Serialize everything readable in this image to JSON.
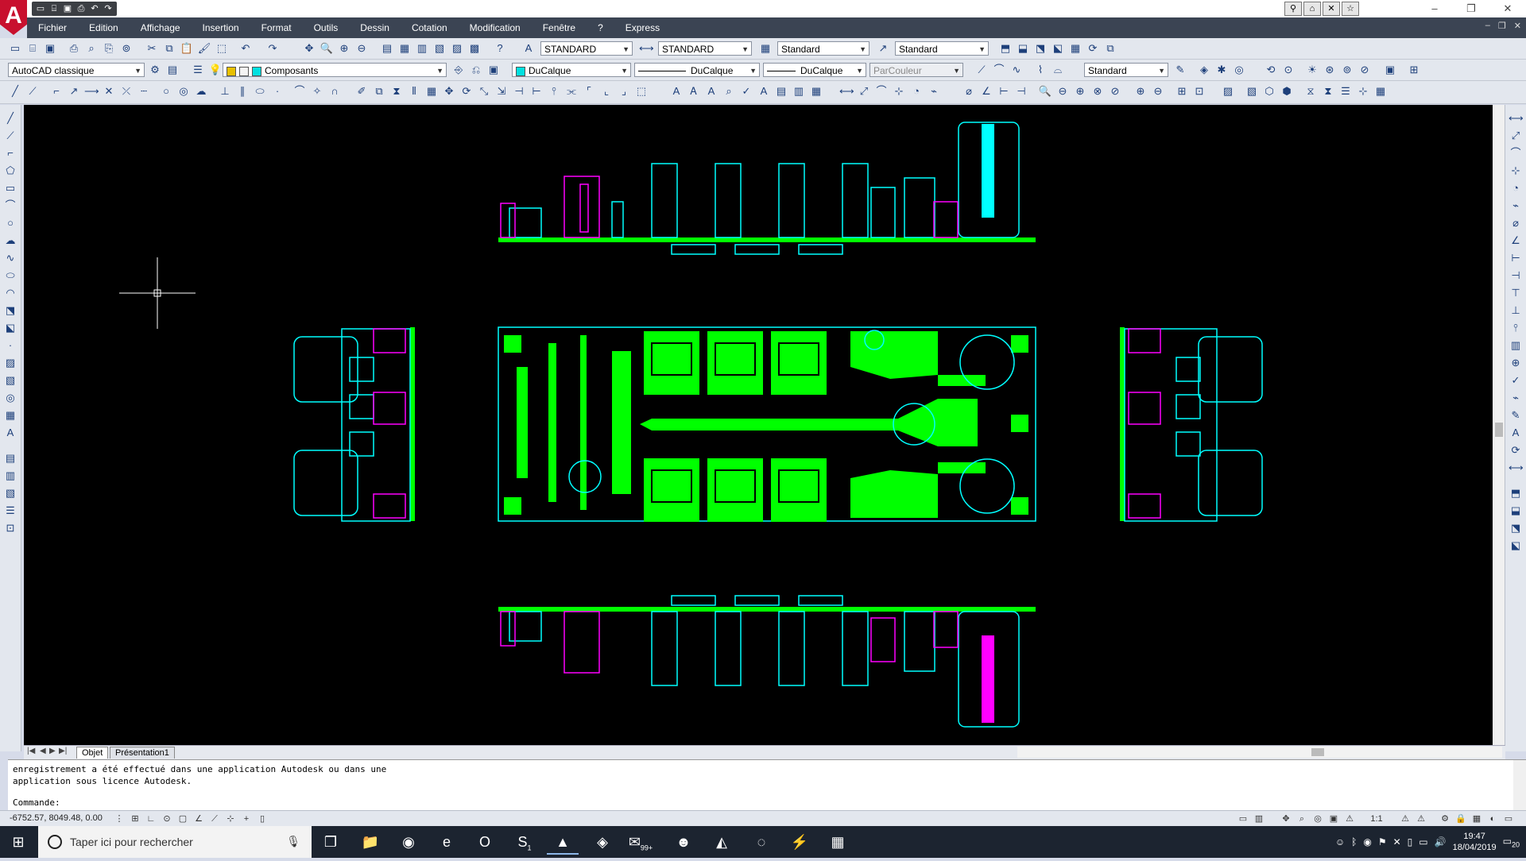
{
  "app": {
    "logo": "A",
    "quick_access_icons": [
      "new-icon",
      "open-icon",
      "save-icon",
      "print-icon",
      "undo-icon",
      "redo-icon"
    ]
  },
  "menu": {
    "items": [
      "Fichier",
      "Edition",
      "Affichage",
      "Insertion",
      "Format",
      "Outils",
      "Dessin",
      "Cotation",
      "Modification",
      "Fenêtre",
      "?",
      "Express"
    ]
  },
  "toolbar_standard": {
    "text_style": "STANDARD",
    "dim_style": "STANDARD",
    "table_style": "Standard",
    "multileader_style": "Standard"
  },
  "toolbar_layers": {
    "workspace": "AutoCAD classique",
    "layer": "Composants",
    "color": "DuCalque",
    "linetype": "DuCalque",
    "lineweight": "DuCalque",
    "plot_style": "ParCouleur",
    "visual_style": "Standard"
  },
  "colors": {
    "canvas": "#000000",
    "copper": "#00ff00",
    "outline": "#00ffff",
    "components": "#ff00ff",
    "silk": "#ff3030",
    "menu_bg": "#3b4453"
  },
  "layout_tabs": {
    "model": "Objet",
    "layout1": "Présentation1"
  },
  "command": {
    "history": "enregistrement a été effectué dans une application Autodesk ou dans une\napplication sous licence Autodesk.",
    "prompt": "Commande:"
  },
  "status": {
    "coordinates": "-6752.57, 8049.48, 0.00",
    "annotation_scale": "1:1"
  },
  "taskbar": {
    "search_placeholder": "Taper ici pour rechercher",
    "mail_badge": "99+",
    "skype_badge": "1",
    "time": "19:47",
    "date": "18/04/2019",
    "notification_count": "20"
  }
}
